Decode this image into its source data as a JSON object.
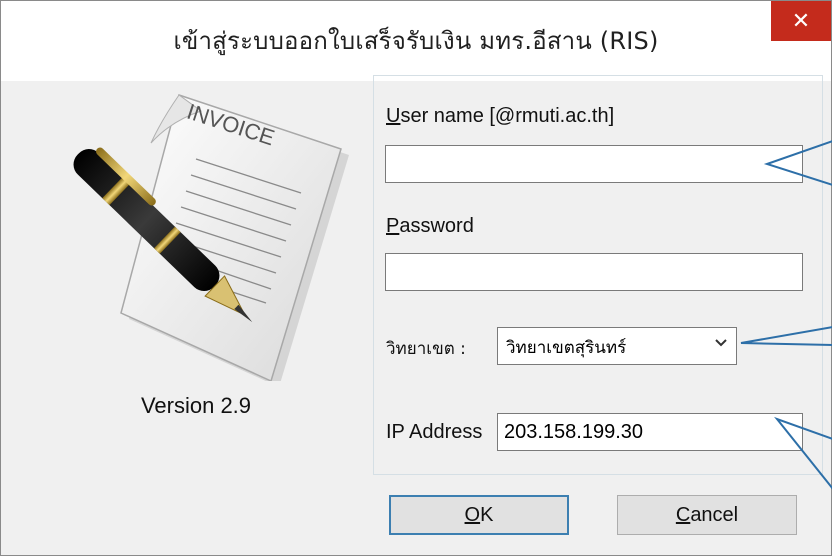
{
  "window": {
    "title": "เข้าสู่ระบบออกใบเสร็จรับเงิน มทร.อีสาน (RIS)",
    "close_glyph": "✕"
  },
  "brand": {
    "invoice_text": "INVOICE",
    "version": "Version 2.9"
  },
  "form": {
    "username_label_prefix": "U",
    "username_label_rest": "ser name [@rmuti.ac.th]",
    "username_value": "",
    "password_label_prefix": "P",
    "password_label_rest": "assword",
    "password_value": "",
    "campus_label": "วิทยาเขต :",
    "campus_selected": "วิทยาเขตสุรินทร์",
    "ip_label": "IP Address",
    "ip_value": "203.158.199.30"
  },
  "buttons": {
    "ok_prefix": "O",
    "ok_rest": "K",
    "cancel_prefix": "C",
    "cancel_rest": "ancel"
  },
  "colors": {
    "close_bg": "#c42b1c",
    "callout_line": "#2d6fa8",
    "default_button_border": "#3c7fb1"
  },
  "icons": {
    "close": "close-icon",
    "dropdown": "chevron-down-icon",
    "invoice": "invoice-pen-icon"
  }
}
